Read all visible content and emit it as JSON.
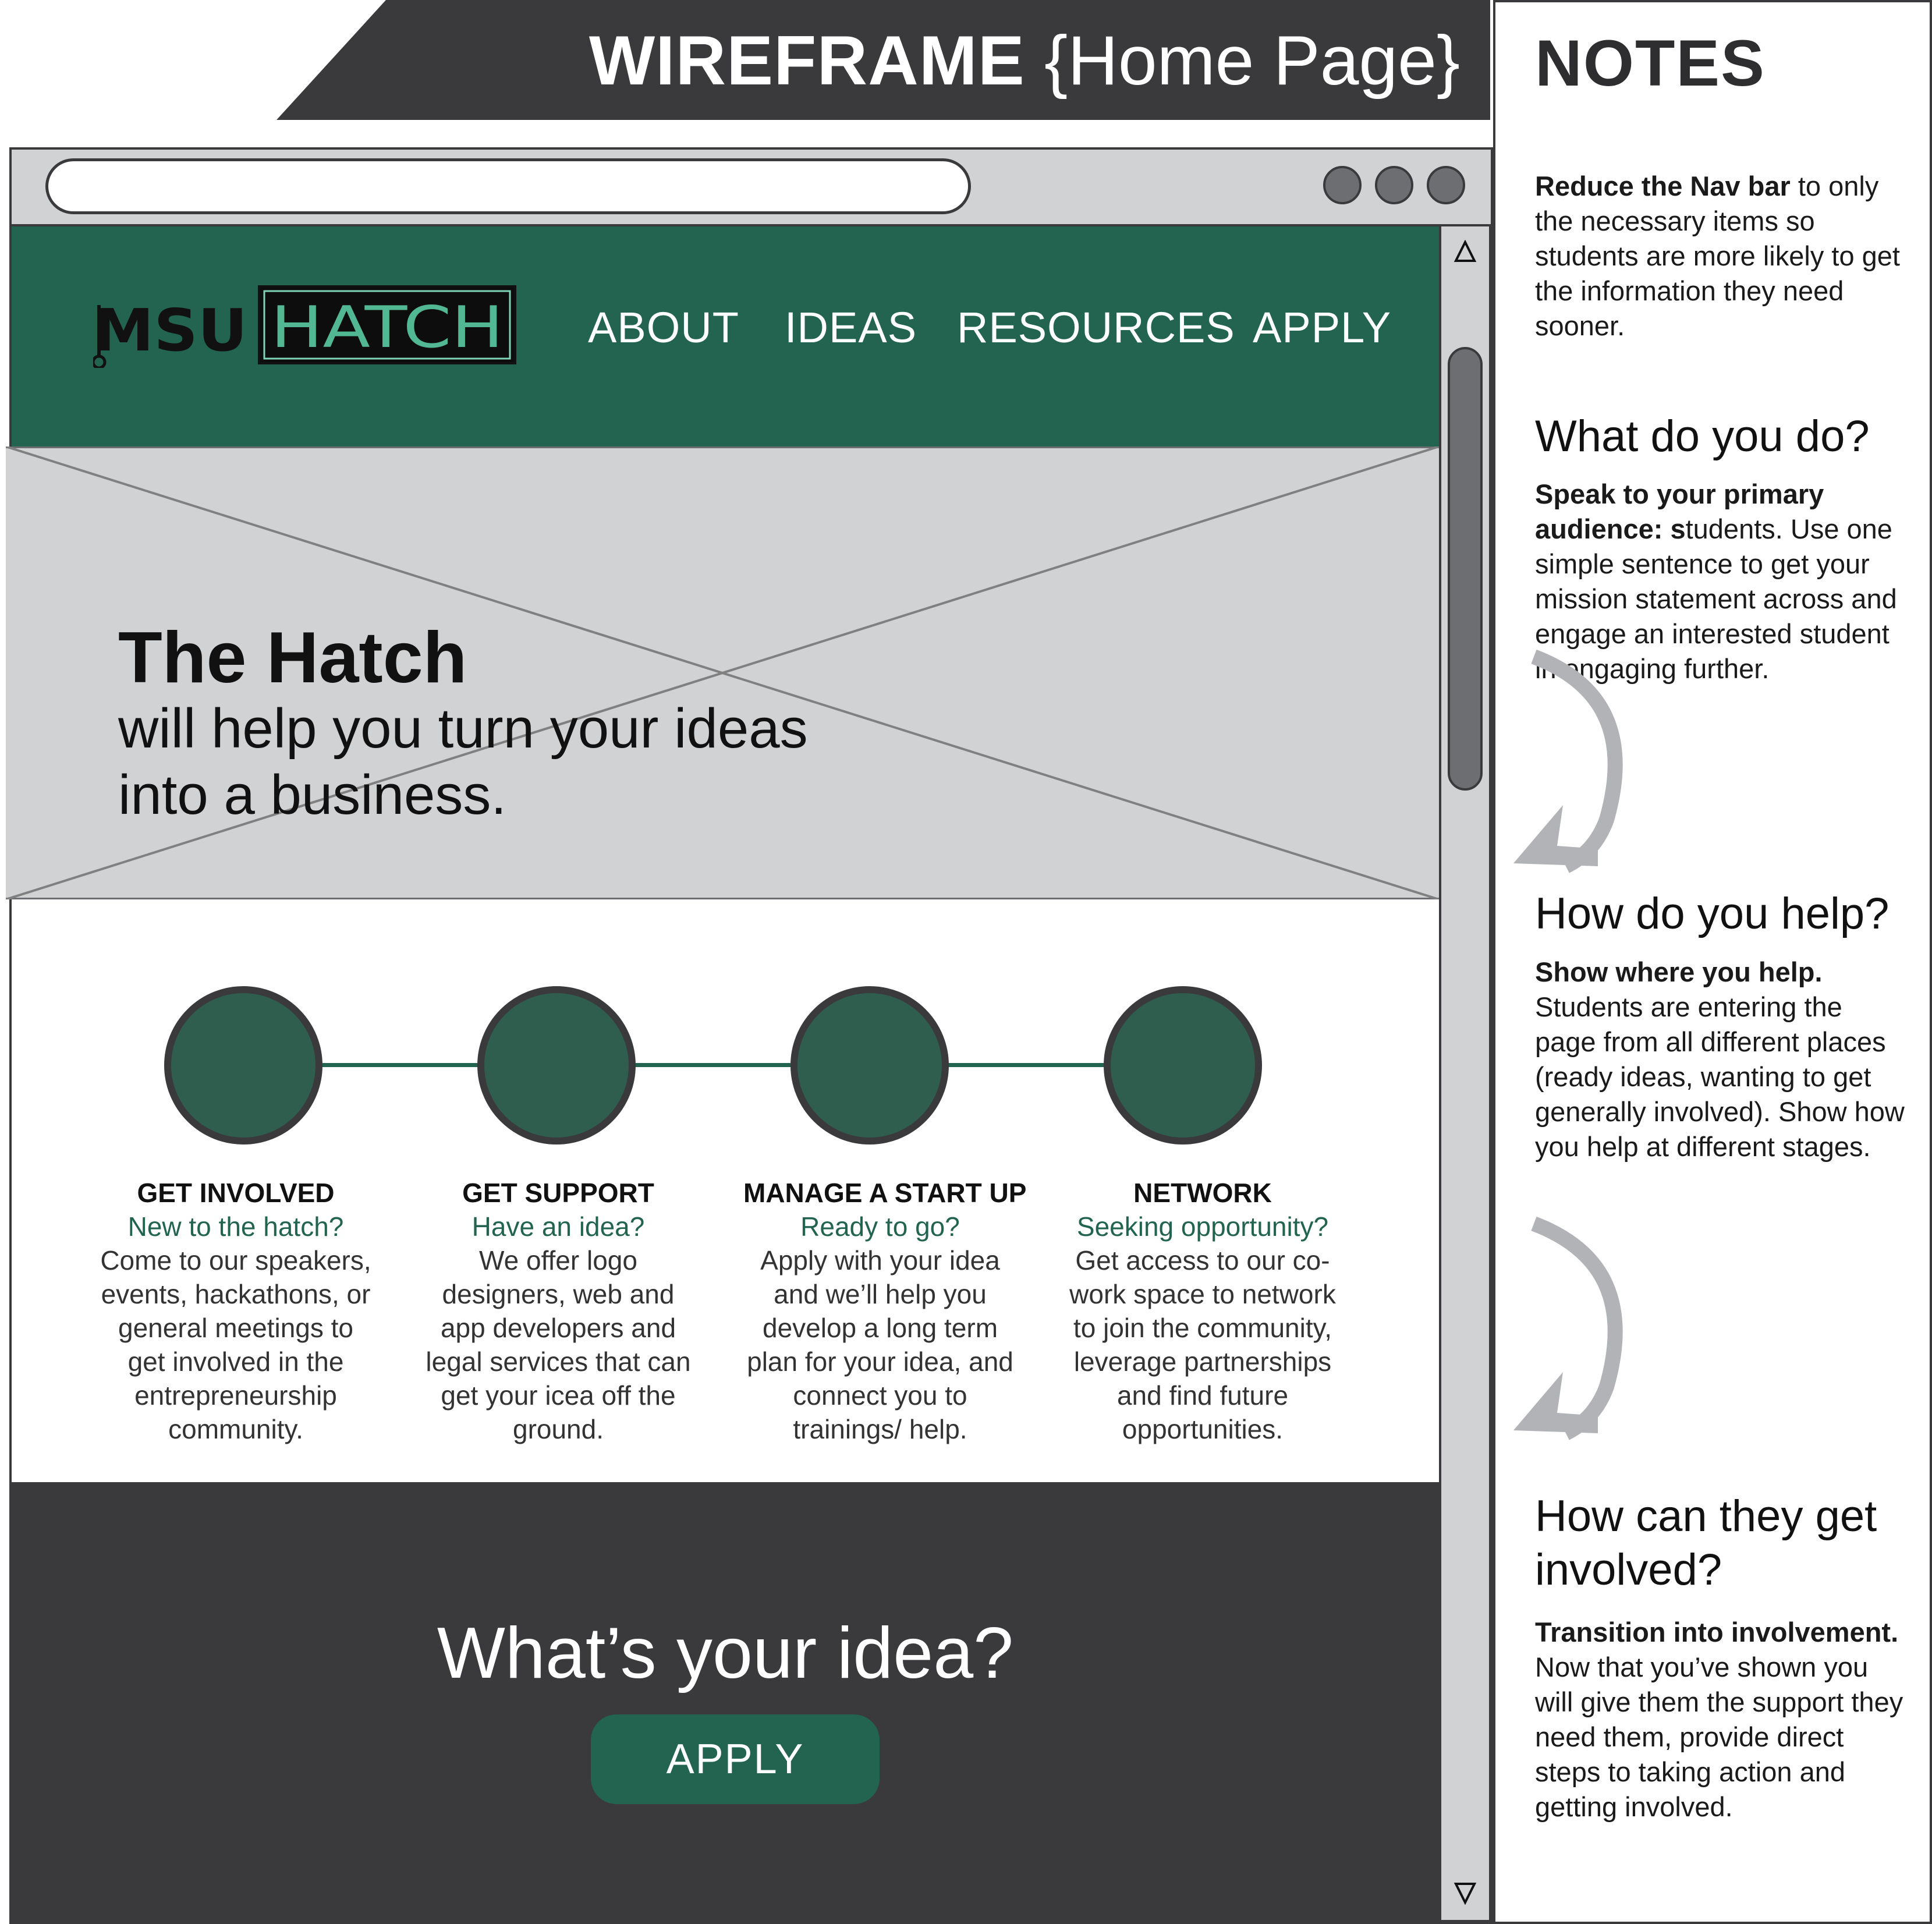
{
  "banner": {
    "title_bold": "WIREFRAME",
    "title_light": "{Home Page}"
  },
  "browser": {
    "url": ""
  },
  "nav": {
    "logo_left": "MSU",
    "logo_right": "HATCH",
    "links": [
      "ABOUT",
      "IDEAS",
      "RESOURCES",
      "APPLY"
    ]
  },
  "hero": {
    "title": "The Hatch",
    "subtitle": "will help you turn your ideas into a business."
  },
  "steps": [
    {
      "title": "GET INVOLVED",
      "question": "New to the hatch?",
      "body": "Come to our speakers, events, hackathons, or general meetings to get involved in the entrepreneurship community."
    },
    {
      "title": "GET SUPPORT",
      "question": "Have an idea?",
      "body": "We offer logo designers, web and app developers and legal services that can get your icea off the ground."
    },
    {
      "title": "MANAGE A START UP",
      "question": "Ready to go?",
      "body": "Apply with your idea and we’ll help you develop a long term plan for your idea, and connect you to trainings/ help."
    },
    {
      "title": "NETWORK",
      "question": "Seeking opportunity?",
      "body": "Get access to our co-work space to network to join the community, leverage partnerships and find future opportunities."
    }
  ],
  "cta": {
    "title": "What’s your idea?",
    "button": "APPLY"
  },
  "notes": {
    "title": "NOTES",
    "n1_bold": "Reduce the Nav bar",
    "n1_text": " to only the necessary items so students are more likely to get the information they need sooner.",
    "h2": "What do you do?",
    "n2_bold": "Speak to your primary audience: s",
    "n2_text": "tudents. Use one simple sentence to  get your mission statement across and engage an interested student in engaging further.",
    "h3": "How do you help?",
    "n3_bold": "Show where you help.",
    "n3_text": " Students are entering the page from all different places (ready ideas, wanting to get generally involved). Show how you help at different stages.",
    "h4": "How can they get involved?",
    "n4_bold": "Transition into involvement.",
    "n4_text": " Now that you’ve shown you will give them the support they need them, provide direct steps to taking action and getting involved."
  },
  "colors": {
    "brand_green": "#226450",
    "dark_gray": "#3a3a3c",
    "light_gray": "#d1d2d4",
    "mid_gray": "#6d6e71"
  },
  "icons": [
    "window-control-icon",
    "scroll-up-icon",
    "scroll-down-icon",
    "curved-arrow-icon"
  ]
}
